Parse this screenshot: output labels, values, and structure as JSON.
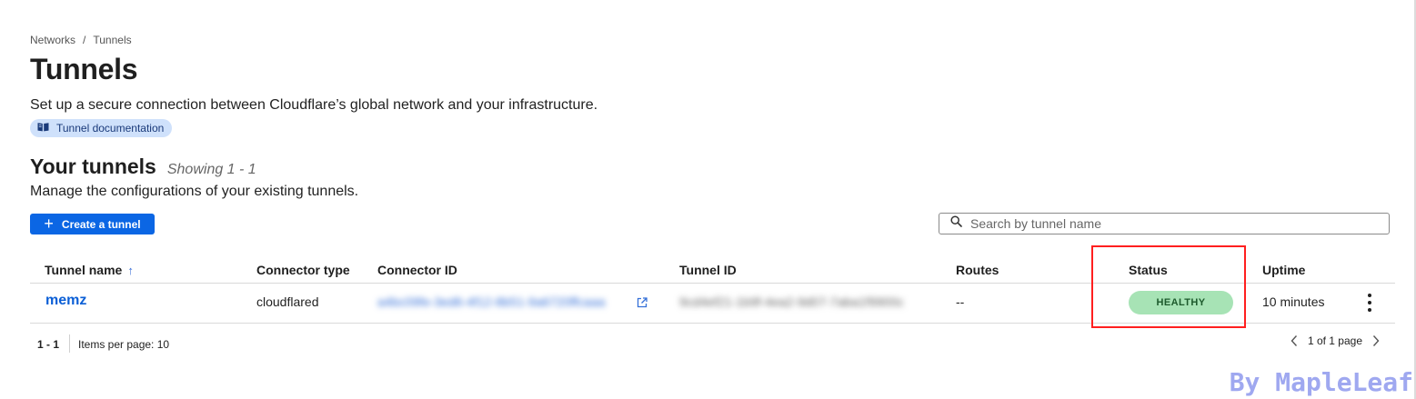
{
  "breadcrumb": {
    "items": [
      "Networks",
      "Tunnels"
    ],
    "separator": "/"
  },
  "page": {
    "title": "Tunnels",
    "subtitle": "Set up a secure connection between Cloudflare’s global network and your infrastructure.",
    "doc_link": "Tunnel documentation"
  },
  "section": {
    "title": "Your tunnels",
    "showing": "Showing 1 - 1",
    "subtitle": "Manage the configurations of your existing tunnels."
  },
  "toolbar": {
    "create_label": "Create a tunnel",
    "search_placeholder": "Search by tunnel name",
    "search_value": ""
  },
  "table": {
    "columns": [
      "Tunnel name",
      "Connector type",
      "Connector ID",
      "Tunnel ID",
      "Routes",
      "Status",
      "Uptime"
    ],
    "sort_indicator": "↑",
    "rows": [
      {
        "name": "memz",
        "connector_type": "cloudflared",
        "connector_id": "a4bc09fe-3ed6-4f12-8b51-9a6720ffcaaa",
        "tunnel_id": "9cd4ef21-1b9f-4ea2-9d07-7aba1f9900c",
        "routes": "--",
        "status": "HEALTHY",
        "uptime": "10 minutes"
      }
    ]
  },
  "footer": {
    "range": "1 - 1",
    "items_per_page": "Items per page: 10",
    "page_info": "1 of 1 page"
  },
  "watermark": "By MapleLeaf",
  "colors": {
    "accent": "#0b66e4",
    "status_healthy_bg": "#a7e3b5",
    "highlight": "#ff1f1f"
  }
}
